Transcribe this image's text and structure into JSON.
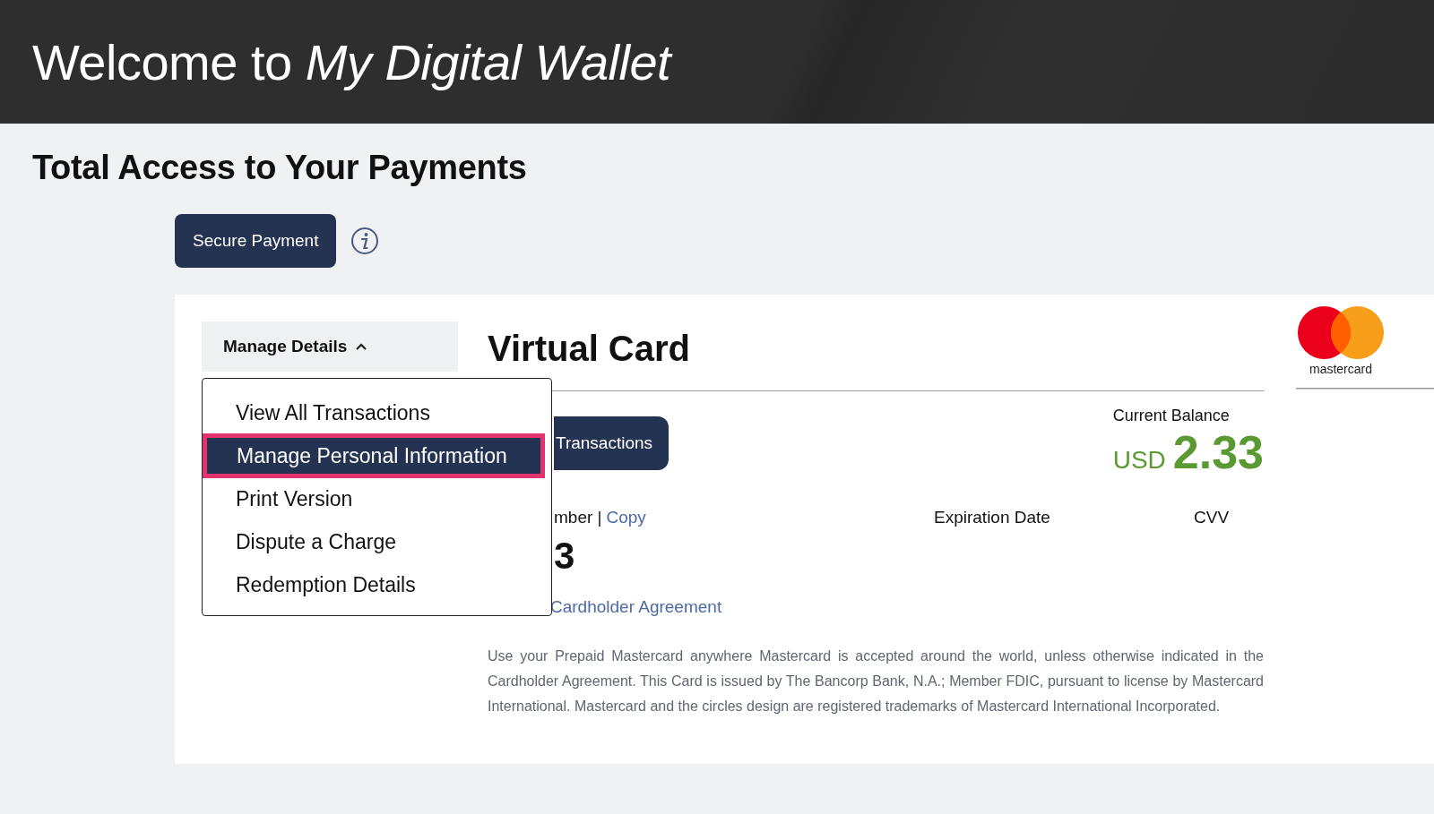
{
  "header": {
    "title": "Welcome to *My Digital Wallet*"
  },
  "page_title": "Total Access to Your Payments",
  "secure_payment_button": "Secure Payment",
  "dropdown": {
    "label": "Manage Details",
    "expanded": true,
    "items": [
      {
        "label": "View All Transactions",
        "selected": false
      },
      {
        "label": "Manage Personal Information",
        "selected": true
      },
      {
        "label": "Print Version",
        "selected": false
      },
      {
        "label": "Dispute a Charge",
        "selected": false
      },
      {
        "label": "Redemption Details",
        "selected": false
      }
    ]
  },
  "card": {
    "title": "Virtual Card",
    "transactions_button": "Transactions",
    "balance_label": "Current Balance",
    "currency": "USD",
    "amount": "2.33",
    "number_label": "mber |",
    "copy_link": "Copy",
    "number_value": "3",
    "expiration_label": "Expiration Date",
    "cvv_label": "CVV",
    "agreement_link": "Cardholder Agreement",
    "disclaimer": "Use your Prepaid Mastercard anywhere Mastercard is accepted around the world, unless otherwise indicated in the Cardholder Agreement. This Card is issued by The Bancorp Bank, N.A.; Member FDIC, pursuant to license by Mastercard International. Mastercard and the circles design are registered trademarks of Mastercard International Incorporated.",
    "brand": "mastercard"
  }
}
